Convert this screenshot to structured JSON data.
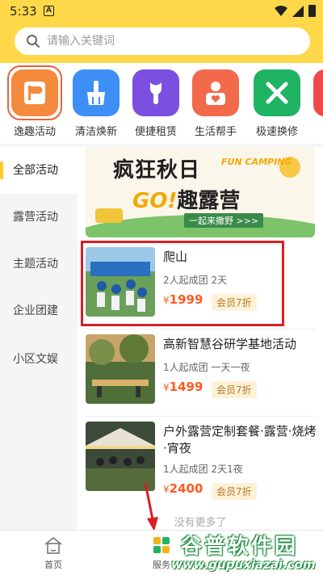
{
  "status_bar": {
    "time": "5:33",
    "notification_badge": "A"
  },
  "search": {
    "placeholder": "请输入关键词",
    "icon": "search-icon"
  },
  "categories": [
    {
      "label": "逸趣活动",
      "icon": "flag-icon",
      "color": "#f58a3c",
      "active": true
    },
    {
      "label": "清洁焕新",
      "icon": "brush-icon",
      "color": "#3d8ef5",
      "active": false
    },
    {
      "label": "便捷租赁",
      "icon": "wrench-icon",
      "color": "#7b4fe0",
      "active": false
    },
    {
      "label": "生活帮手",
      "icon": "helper-icon",
      "color": "#f26a4a",
      "active": false
    },
    {
      "label": "极速换修",
      "icon": "tools-icon",
      "color": "#1fb364",
      "active": false
    },
    {
      "label": "",
      "icon": "partial-icon",
      "color": "#f04848",
      "active": false
    }
  ],
  "sidebar": {
    "items": [
      {
        "label": "全部活动",
        "active": true
      },
      {
        "label": "露营活动",
        "active": false
      },
      {
        "label": "主题活动",
        "active": false
      },
      {
        "label": "企业团建",
        "active": false
      },
      {
        "label": "小区文娱",
        "active": false
      }
    ]
  },
  "banner": {
    "line1": "疯狂秋日",
    "line1_en": "FUN CAMPING",
    "go": "GO!",
    "line2": "趣露营",
    "tag": "一起来撒野 >>>"
  },
  "activities": [
    {
      "title": "爬山",
      "meta": "2人起成团 2天",
      "currency": "¥",
      "price": "1999",
      "vip": "会员7折"
    },
    {
      "title": "高新智慧谷研学基地活动",
      "meta": "1人起成团 一天一夜",
      "currency": "¥",
      "price": "1499",
      "vip": "会员7折"
    },
    {
      "title": "户外露营定制套餐·露营·烧烤·宵夜",
      "meta": "1人起成团 2天1夜",
      "currency": "¥",
      "price": "2400",
      "vip": "会员7折"
    }
  ],
  "list_end": "没有更多了",
  "bottom_nav": [
    {
      "label": "首页",
      "icon": "home-icon"
    },
    {
      "label": "服务",
      "icon": "service-icon"
    }
  ],
  "watermark": {
    "name": "谷普软件园",
    "url": "www.gupuxiazai.com"
  },
  "colors": {
    "header": "#ffd84a",
    "accent_price": "#ff5a1f",
    "highlight_border": "#d81f26"
  }
}
